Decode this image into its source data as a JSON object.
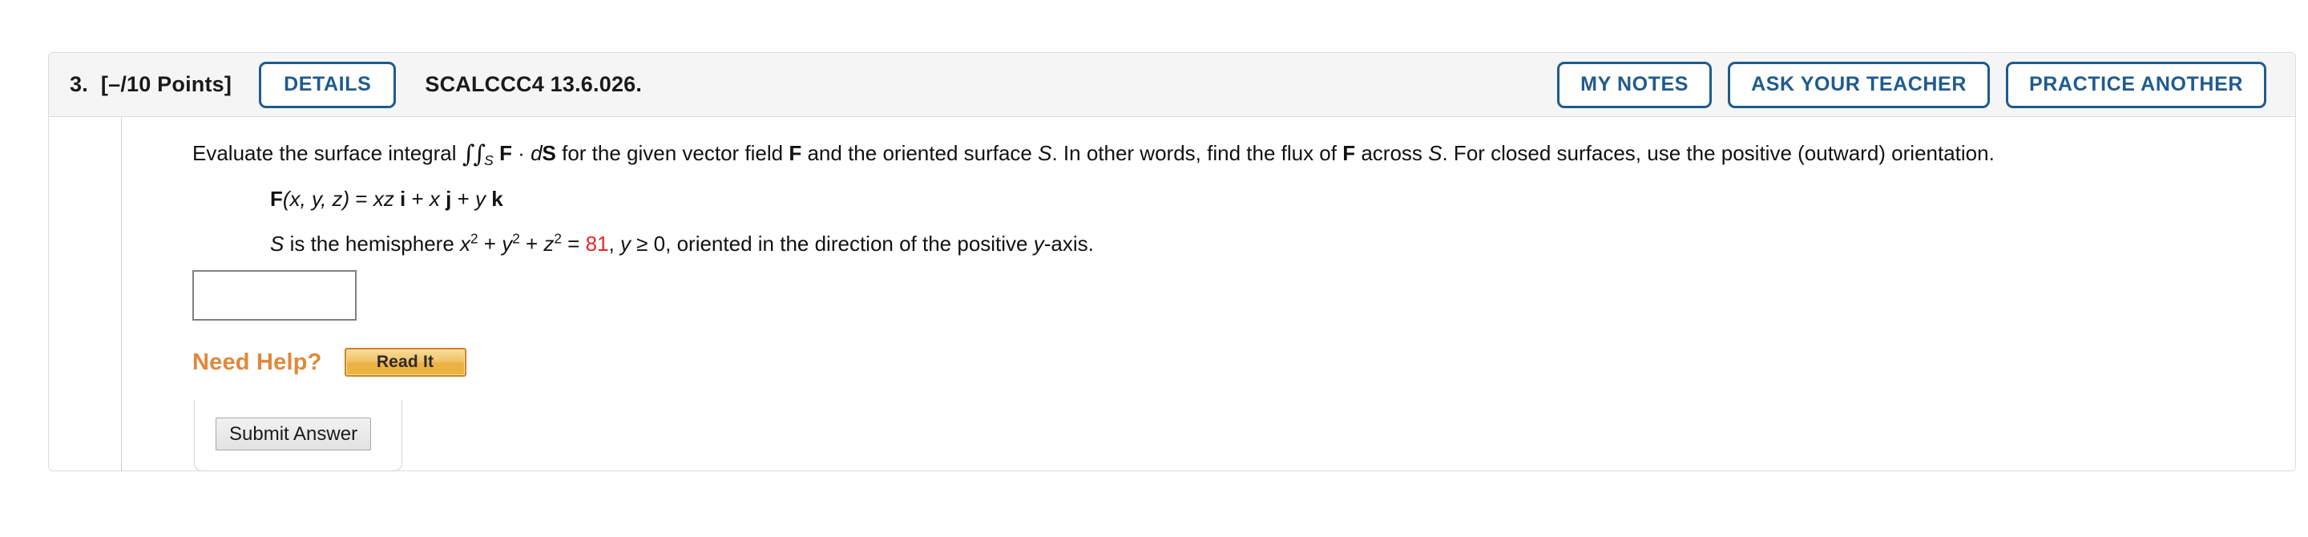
{
  "header": {
    "question_number": "3.",
    "points": "[–/10 Points]",
    "details_label": "DETAILS",
    "textbook_code": "SCALCCC4 13.6.026.",
    "my_notes_label": "MY NOTES",
    "ask_your_teacher_label": "ASK YOUR TEACHER",
    "practice_another_label": "PRACTICE ANOTHER"
  },
  "problem": {
    "prompt_part1": "Evaluate the surface integral ",
    "prompt_integral": "∫∫",
    "prompt_integral_sub": "S",
    "prompt_part2": " for the given vector field ",
    "prompt_F": "F",
    "prompt_part3": " and the oriented surface ",
    "prompt_S": "S",
    "prompt_part4": ". In other words, find the flux of ",
    "prompt_part5": " across ",
    "prompt_part6": ". For closed surfaces, use the positive (outward) orientation.",
    "field_F": "F",
    "field_args": "(x, y, z)",
    "field_equals": " = ",
    "field_term1": "xz",
    "field_i": "i",
    "field_plus1": " + ",
    "field_term2": "x",
    "field_j": "j",
    "field_plus2": " + ",
    "field_term3": "y",
    "field_k": "k",
    "surface_S": "S",
    "surface_text1": " is the hemisphere ",
    "surface_x": "x",
    "surface_y": "y",
    "surface_z": "z",
    "surface_exp": "2",
    "surface_plus": " + ",
    "surface_equals": " = ",
    "surface_radius_sq": "81",
    "surface_text2": ", ",
    "surface_condition": "y",
    "surface_condition_rest": " ≥ 0, oriented in the direction of the positive ",
    "surface_axis": "y",
    "surface_axis_rest": "-axis."
  },
  "answer": {
    "value": "",
    "placeholder": ""
  },
  "help": {
    "need_help_label": "Need Help?",
    "read_it_label": "Read It"
  },
  "submit": {
    "label": "Submit Answer"
  },
  "colors": {
    "accent_blue": "#1f5b8d",
    "highlight_red": "#e8262b",
    "help_orange": "#e0883a",
    "header_bg": "#f5f5f5"
  }
}
